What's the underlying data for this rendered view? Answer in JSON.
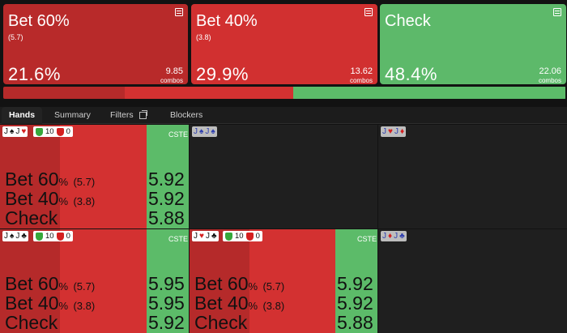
{
  "actions": [
    {
      "name": "Bet 60%",
      "size": "(5.7)",
      "pct": "21.6%",
      "combos": "9.85",
      "combos_label": "combos",
      "color": "#b82a2a"
    },
    {
      "name": "Bet 40%",
      "size": "(3.8)",
      "pct": "29.9%",
      "combos": "13.62",
      "combos_label": "combos",
      "color": "#d13030"
    },
    {
      "name": "Check",
      "size": "",
      "pct": "48.4%",
      "combos": "22.06",
      "combos_label": "combos",
      "color": "#5db96a"
    }
  ],
  "frequency_bar": [
    0.216,
    0.299,
    0.484
  ],
  "tabs": [
    "Hands",
    "Summary",
    "Filters",
    "Blockers"
  ],
  "colors": {
    "bet60": "#b52a2a",
    "bet40": "#d33131",
    "check": "#5cbb69",
    "empty": "#1f1f1f"
  },
  "cells": [
    {
      "hand": [
        "J",
        "♠",
        "J",
        "♥"
      ],
      "badge_green": "10",
      "badge_red": "0",
      "cste": "CSTE",
      "rows": [
        {
          "label": "Bet 60",
          "pct": "%",
          "size": "(5.7)",
          "ev": "5.92"
        },
        {
          "label": "Bet 40",
          "pct": "%",
          "size": "(3.8)",
          "ev": "5.92"
        },
        {
          "label": "Check",
          "pct": "",
          "size": "",
          "ev": "5.88"
        }
      ]
    },
    {
      "hand": [
        "J",
        "♠",
        "J",
        "♠"
      ]
    },
    {
      "hand": [
        "J",
        "♥",
        "J",
        "♦"
      ]
    },
    {
      "hand": [
        "J",
        "♠",
        "J",
        "♣"
      ],
      "badge_green": "10",
      "badge_red": "0",
      "cste": "CSTE",
      "rows": [
        {
          "label": "Bet 60",
          "pct": "%",
          "size": "(5.7)",
          "ev": "5.95"
        },
        {
          "label": "Bet 40",
          "pct": "%",
          "size": "(3.8)",
          "ev": "5.95"
        },
        {
          "label": "Check",
          "pct": "",
          "size": "",
          "ev": "5.92"
        }
      ]
    },
    {
      "hand": [
        "J",
        "♥",
        "J",
        "♣"
      ],
      "badge_green": "10",
      "badge_red": "0",
      "cste": "CSTE",
      "rows": [
        {
          "label": "Bet 60",
          "pct": "%",
          "size": "(5.7)",
          "ev": "5.92"
        },
        {
          "label": "Bet 40",
          "pct": "%",
          "size": "(3.8)",
          "ev": "5.92"
        },
        {
          "label": "Check",
          "pct": "",
          "size": "",
          "ev": "5.88"
        }
      ]
    },
    {
      "hand": [
        "J",
        "♦",
        "J",
        "♣"
      ]
    }
  ]
}
